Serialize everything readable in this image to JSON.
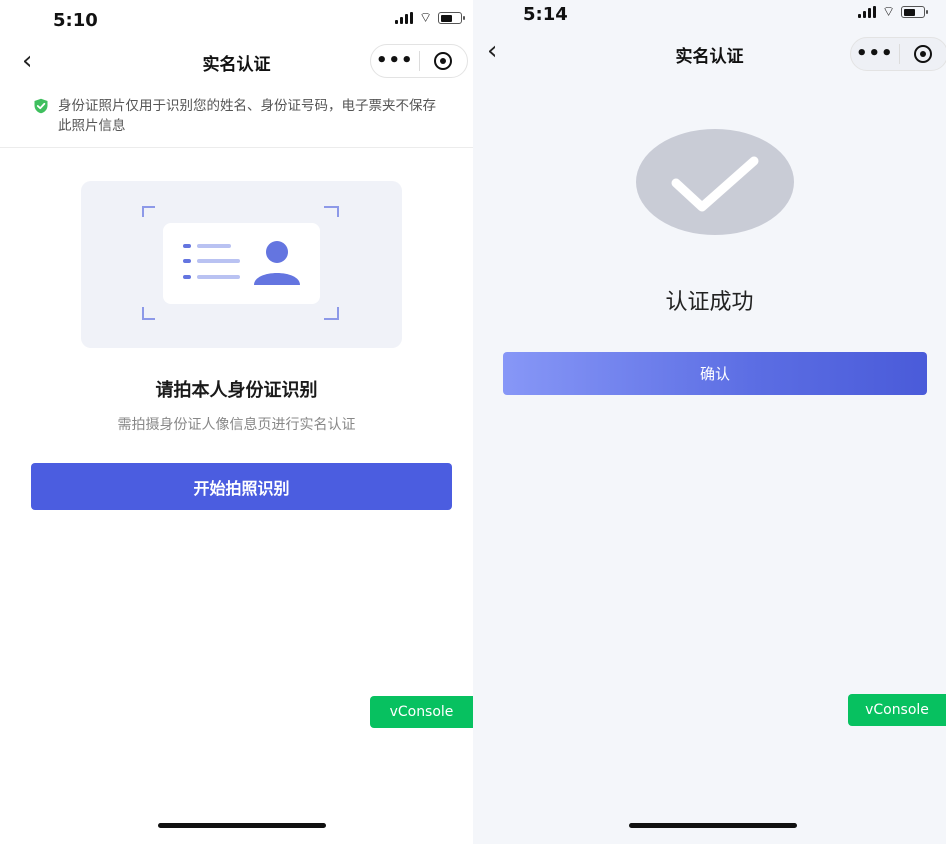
{
  "left": {
    "status": {
      "time": "5:10"
    },
    "nav": {
      "title": "实名认证",
      "more_label": "•••"
    },
    "notice": {
      "text": "身份证照片仅用于识别您的姓名、身份证号码，电子票夹不保存此照片信息"
    },
    "capture": {
      "title": "请拍本人身份证识别",
      "subtitle": "需拍摄身份证人像信息页进行实名认证",
      "button_label": "开始拍照识别"
    },
    "vconsole": "vConsole"
  },
  "right": {
    "status": {
      "time": "5:14"
    },
    "nav": {
      "title": "实名认证",
      "more_label": "•••"
    },
    "success": {
      "text": "认证成功",
      "confirm_label": "确认"
    },
    "vconsole": "vConsole"
  },
  "colors": {
    "primary": "#4b5de0",
    "shield": "#3fbf5e",
    "vconsole": "#07c160",
    "success_circle": "#c9ccd6"
  }
}
